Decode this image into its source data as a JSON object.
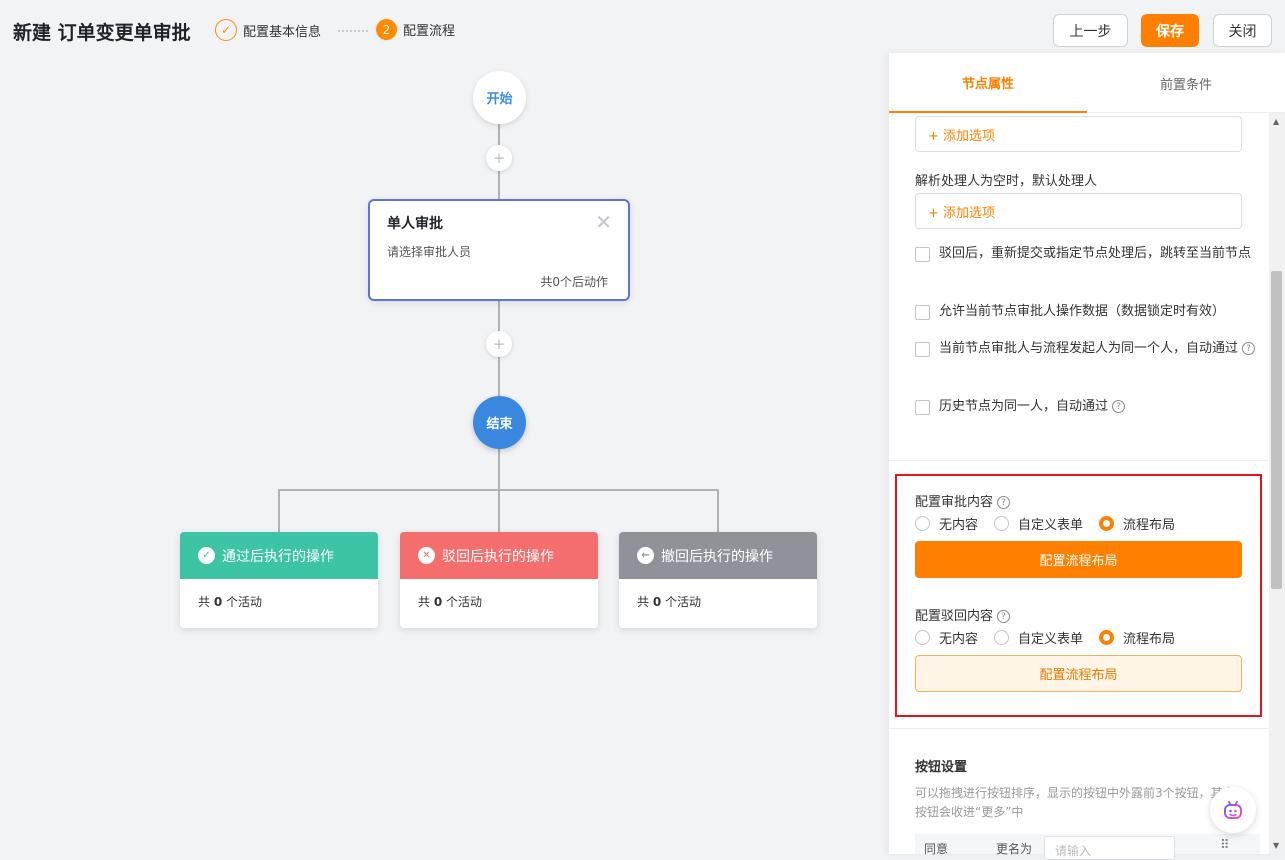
{
  "header": {
    "title": "新建 订单变更单审批",
    "step1_label": "配置基本信息",
    "step2_number": "2",
    "step2_label": "配置流程",
    "prev_label": "上一步",
    "save_label": "保存",
    "close_label": "关闭"
  },
  "flow": {
    "start_label": "开始",
    "end_label": "结束",
    "plus_symbol": "+",
    "approve_node": {
      "title": "单人审批",
      "subtitle": "请选择审批人员",
      "count": "共0个后动作"
    },
    "ops": [
      {
        "title": "通过后执行的操作",
        "count_prefix": "共",
        "count": "0",
        "count_suffix": "个活动",
        "color": "#3cc4a5"
      },
      {
        "title": "驳回后执行的操作",
        "count_prefix": "共",
        "count": "0",
        "count_suffix": "个活动",
        "color": "#f46e6e"
      },
      {
        "title": "撤回后执行的操作",
        "count_prefix": "共",
        "count": "0",
        "count_suffix": "个活动",
        "color": "#8f9399"
      }
    ]
  },
  "panel": {
    "tab_node": "节点属性",
    "tab_pre": "前置条件",
    "add_option": "+ 添加选项",
    "empty_handler_label": "解析处理人为空时，默认处理人",
    "checkboxes": [
      "驳回后，重新提交或指定节点处理后，跳转至当前节点",
      "允许当前节点审批人操作数据（数据锁定时有效）",
      "当前节点审批人与流程发起人为同一个人，自动通过",
      "历史节点为同一人，自动通过"
    ],
    "approve_content_label": "配置审批内容",
    "reject_content_label": "配置驳回内容",
    "radio_options": [
      "无内容",
      "自定义表单",
      "流程布局"
    ],
    "radio_selected": "流程布局",
    "config_layout_btn": "配置流程布局",
    "button_settings_title": "按钮设置",
    "button_settings_desc": "可以拖拽进行按钮排序，显示的按钮中外露前3个按钮，其余按钮会收进“更多”中",
    "table_row": {
      "name": "同意",
      "rename_label": "更名为",
      "rename_placeholder": "请输入"
    }
  },
  "colors": {
    "accent": "#ff8000",
    "end_node": "#3a87e0",
    "highlight_box": "#e2141f"
  }
}
